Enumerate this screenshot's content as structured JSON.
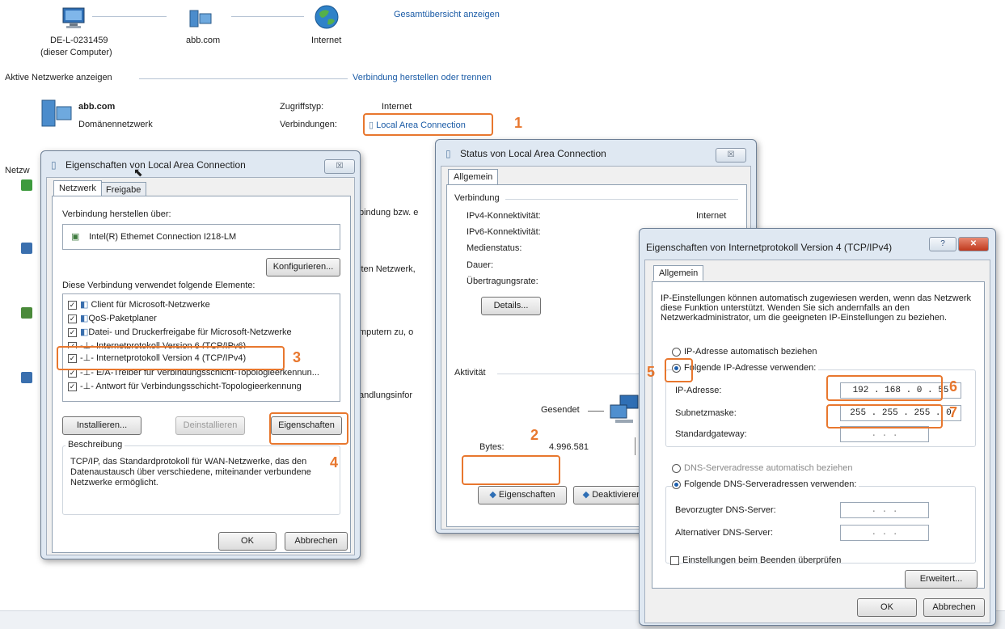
{
  "network_map": {
    "computer_name": "DE-L-0231459",
    "computer_sub": "(dieser Computer)",
    "domain": "abb.com",
    "internet": "Internet",
    "overview_link": "Gesamtübersicht anzeigen"
  },
  "active_networks": {
    "heading": "Aktive Netzwerke anzeigen",
    "connect_link": "Verbindung herstellen oder trennen",
    "network_name": "abb.com",
    "network_type": "Domänennetzwerk",
    "access_label": "Zugriffstyp:",
    "access_value": "Internet",
    "connections_label": "Verbindungen:",
    "connection_link": "Local Area Connection"
  },
  "background_fragments": {
    "netzw": "Netzw",
    "f1": "bindung bzw. e",
    "f2": "lten Netzwerk,",
    "f3": "mputern zu, o",
    "f4": "andlungsinfor"
  },
  "props_dialog": {
    "title": "Eigenschaften von Local Area Connection",
    "close": "☒",
    "tabs": [
      "Netzwerk",
      "Freigabe"
    ],
    "connect_via_label": "Verbindung herstellen über:",
    "adapter": "Intel(R) Ethemet Connection I218-LM",
    "configure_button": "Konfigurieren...",
    "elements_label": "Diese Verbindung verwendet folgende Elemente:",
    "items": [
      {
        "label": "Client für Microsoft-Netzwerke",
        "checked": true
      },
      {
        "label": "QoS-Paketplaner",
        "checked": true
      },
      {
        "label": "Datei- und Druckerfreigabe für Microsoft-Netzwerke",
        "checked": true
      },
      {
        "label": "Internetprotokoll Version 6 (TCP/IPv6)",
        "checked": true
      },
      {
        "label": "Internetprotokoll Version 4 (TCP/IPv4)",
        "checked": true
      },
      {
        "label": "E/A-Treiber für Verbindungsschicht-Topologieerkennun...",
        "checked": true
      },
      {
        "label": "Antwort für Verbindungsschicht-Topologieerkennung",
        "checked": true
      }
    ],
    "install_button": "Installieren...",
    "uninstall_button": "Deinstallieren",
    "properties_button": "Eigenschaften",
    "description_label": "Beschreibung",
    "description_text": "TCP/IP, das Standardprotokoll für WAN-Netzwerke, das den Datenaustausch über verschiedene, miteinander verbundene Netzwerke ermöglicht.",
    "ok_button": "OK",
    "cancel_button": "Abbrechen"
  },
  "status_dialog": {
    "title": "Status von Local Area Connection",
    "close": "☒",
    "tab": "Allgemein",
    "connection_group": "Verbindung",
    "ipv4_label": "IPv4-Konnektivität:",
    "ipv4_value": "Internet",
    "ipv6_label": "IPv6-Konnektivität:",
    "media_label": "Medienstatus:",
    "duration_label": "Dauer:",
    "speed_label": "Übertragungsrate:",
    "details_button": "Details...",
    "activity_group": "Aktivität",
    "sent_label": "Gesendet",
    "bytes_label": "Bytes:",
    "bytes_value": "4.996.581",
    "properties_button": "Eigenschaften",
    "deactivate_button": "Deaktivieren"
  },
  "ipv4_dialog": {
    "title": "Eigenschaften von Internetprotokoll Version 4 (TCP/IPv4)",
    "help": "?",
    "close": "✕",
    "tab": "Allgemein",
    "intro": "IP-Einstellungen können automatisch zugewiesen werden, wenn das Netzwerk diese Funktion unterstützt. Wenden Sie sich andernfalls an den Netzwerkadministrator, um die geeigneten IP-Einstellungen zu beziehen.",
    "auto_ip": "IP-Adresse automatisch beziehen",
    "manual_ip": "Folgende IP-Adresse verwenden:",
    "ip_label": "IP-Adresse:",
    "ip_value": "192 . 168 .  0  . 55",
    "subnet_label": "Subnetzmaske:",
    "subnet_value": "255 . 255 . 255 .  0",
    "gateway_label": "Standardgateway:",
    "empty_ip": ".       .       .",
    "auto_dns": "DNS-Serveradresse automatisch beziehen",
    "manual_dns": "Folgende DNS-Serveradressen verwenden:",
    "preferred_dns_label": "Bevorzugter DNS-Server:",
    "alternate_dns_label": "Alternativer DNS-Server:",
    "validate_label": "Einstellungen beim Beenden überprüfen",
    "advanced_button": "Erweitert...",
    "ok_button": "OK",
    "cancel_button": "Abbrechen"
  },
  "callouts": [
    "1",
    "2",
    "3",
    "4",
    "5",
    "6",
    "7"
  ],
  "colors": {
    "highlight": "#e8772e",
    "link": "#1a5ba6",
    "selected_radio": "#1d5fae"
  }
}
